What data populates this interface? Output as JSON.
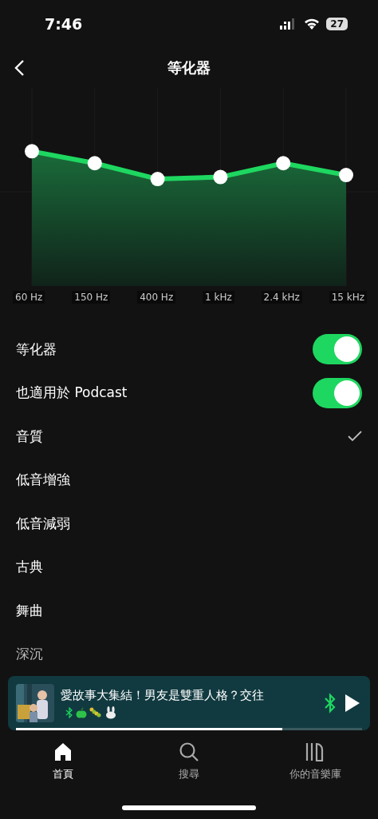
{
  "status_bar": {
    "time": "7:46",
    "battery": "27"
  },
  "header": {
    "title": "等化器"
  },
  "equalizer": {
    "bands": [
      {
        "label": "60 Hz"
      },
      {
        "label": "150 Hz"
      },
      {
        "label": "400 Hz"
      },
      {
        "label": "1 kHz"
      },
      {
        "label": "2.4 kHz"
      },
      {
        "label": "15 kHz"
      }
    ]
  },
  "settings": [
    {
      "kind": "toggle",
      "label": "等化器",
      "on": true
    },
    {
      "kind": "toggle",
      "label": "也適用於 Podcast",
      "on": true
    },
    {
      "kind": "preset",
      "label": "音質",
      "selected": true
    },
    {
      "kind": "preset",
      "label": "低音增強",
      "selected": false
    },
    {
      "kind": "preset",
      "label": "低音減弱",
      "selected": false
    },
    {
      "kind": "preset",
      "label": "古典",
      "selected": false
    },
    {
      "kind": "preset",
      "label": "舞曲",
      "selected": false
    },
    {
      "kind": "preset",
      "label": "深沉",
      "selected": false
    }
  ],
  "mini_player": {
    "title": "愛故事大集結！男友是雙重人格？交往",
    "level": 0.77
  },
  "tab_bar": [
    {
      "kind": "home",
      "label": "首頁",
      "selected": true
    },
    {
      "kind": "search",
      "label": "搜尋",
      "selected": false
    },
    {
      "kind": "library",
      "label": "你的音樂庫",
      "selected": false
    }
  ]
}
